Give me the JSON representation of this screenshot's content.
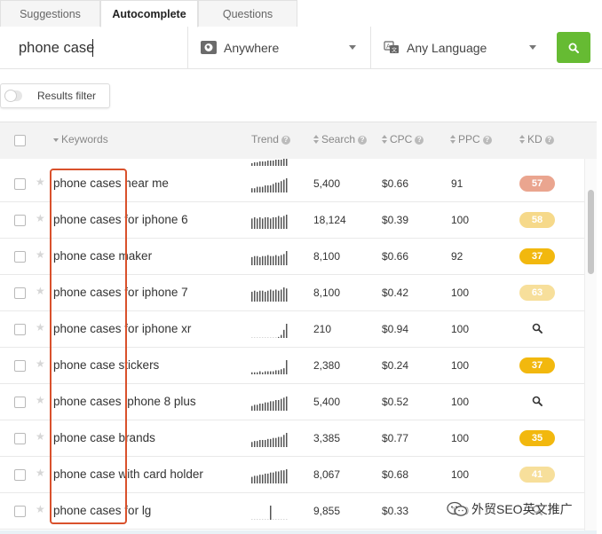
{
  "tabs": [
    {
      "label": "Suggestions",
      "active": false
    },
    {
      "label": "Autocomplete",
      "active": true
    },
    {
      "label": "Questions",
      "active": false
    }
  ],
  "search": {
    "query": "phone case",
    "location": "Anywhere",
    "language": "Any Language"
  },
  "filter": {
    "label": "Results filter",
    "enabled": false
  },
  "table": {
    "headers": {
      "keywords": "Keywords",
      "trend": "Trend",
      "search": "Search",
      "cpc": "CPC",
      "ppc": "PPC",
      "kd": "KD"
    },
    "rows": [
      {
        "keyword": "phone cases near me",
        "trend": [
          3,
          3,
          4,
          4,
          4,
          5,
          5,
          5,
          6,
          7,
          7,
          8,
          9,
          10
        ],
        "search": "5,400",
        "cpc": "$0.66",
        "ppc": "91",
        "kd": "57",
        "kd_color": "#eaa58f"
      },
      {
        "keyword": "phone cases for iphone 6",
        "trend": [
          8,
          9,
          8,
          9,
          8,
          9,
          9,
          8,
          9,
          9,
          10,
          9,
          10,
          11
        ],
        "search": "18,124",
        "cpc": "$0.39",
        "ppc": "100",
        "kd": "58",
        "kd_color": "#f6d98a"
      },
      {
        "keyword": "phone case maker",
        "trend": [
          8,
          9,
          9,
          8,
          9,
          9,
          10,
          9,
          9,
          10,
          9,
          10,
          11,
          14
        ],
        "search": "8,100",
        "cpc": "$0.66",
        "ppc": "92",
        "kd": "37",
        "kd_color": "#f2b80e"
      },
      {
        "keyword": "phone cases for iphone 7",
        "trend": [
          9,
          10,
          9,
          10,
          10,
          9,
          10,
          11,
          10,
          11,
          10,
          11,
          13,
          12
        ],
        "search": "8,100",
        "cpc": "$0.42",
        "ppc": "100",
        "kd": "63",
        "kd_color": "#f7df9b"
      },
      {
        "keyword": "phone cases for iphone xr",
        "trend": [
          0,
          0,
          0,
          0,
          0,
          0,
          0,
          0,
          0,
          0,
          1,
          3,
          8,
          14
        ],
        "search": "210",
        "cpc": "$0.94",
        "ppc": "100",
        "kd": "",
        "kd_color": ""
      },
      {
        "keyword": "phone case stickers",
        "trend": [
          2,
          2,
          2,
          3,
          2,
          3,
          3,
          3,
          3,
          4,
          4,
          5,
          6,
          14
        ],
        "search": "2,380",
        "cpc": "$0.24",
        "ppc": "100",
        "kd": "37",
        "kd_color": "#f2b80e"
      },
      {
        "keyword": "phone cases iphone 8 plus",
        "trend": [
          4,
          5,
          5,
          6,
          6,
          7,
          7,
          8,
          8,
          9,
          9,
          10,
          11,
          12
        ],
        "search": "5,400",
        "cpc": "$0.52",
        "ppc": "100",
        "kd": "",
        "kd_color": ""
      },
      {
        "keyword": "phone case brands",
        "trend": [
          5,
          6,
          6,
          7,
          7,
          7,
          8,
          8,
          9,
          9,
          10,
          10,
          12,
          14
        ],
        "search": "3,385",
        "cpc": "$0.77",
        "ppc": "100",
        "kd": "35",
        "kd_color": "#f2b80e"
      },
      {
        "keyword": "phone case with card holder",
        "trend": [
          6,
          7,
          7,
          8,
          8,
          9,
          9,
          10,
          10,
          11,
          11,
          12,
          12,
          13
        ],
        "search": "8,067",
        "cpc": "$0.68",
        "ppc": "100",
        "kd": "41",
        "kd_color": "#f7df9b"
      },
      {
        "keyword": "phone cases for lg",
        "trend": [
          0,
          0,
          0,
          0,
          0,
          0,
          0,
          1,
          0,
          0,
          0,
          0,
          0,
          0
        ],
        "search": "9,855",
        "cpc": "$0.33",
        "ppc": "100",
        "kd": "",
        "kd_color": ""
      }
    ]
  },
  "watermark": {
    "text": "外贸SEO英文推广"
  },
  "colors": {
    "accent_green": "#66bb33",
    "highlight": "#d9512c"
  }
}
